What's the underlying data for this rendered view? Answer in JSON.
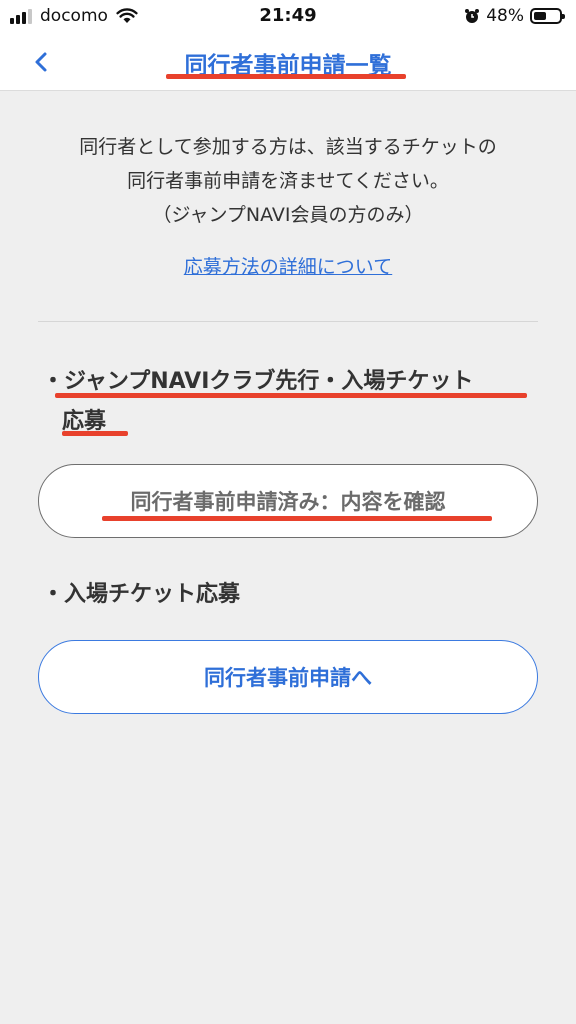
{
  "status_bar": {
    "carrier": "docomo",
    "time": "21:49",
    "battery_percent": "48%",
    "battery_level": 0.48
  },
  "nav": {
    "title": "同行者事前申請一覧",
    "back_icon": "chevron-left-icon"
  },
  "intro": {
    "line1": "同行者として参加する方は、該当するチケットの",
    "line2": "同行者事前申請を済ませてください。",
    "line3": "（ジャンプNAVI会員の方のみ）"
  },
  "detail_link": "応募方法の詳細について",
  "sections": [
    {
      "title_line1": "・ジャンプNAVIクラブ先行・入場チケット",
      "title_line2": "応募",
      "button_label": "同行者事前申請済み：内容を確認"
    },
    {
      "title_line1": "・入場チケット応募",
      "button_label": "同行者事前申請へ"
    }
  ],
  "colors": {
    "accent": "#2f6fd8",
    "annotation_red": "#e8412c",
    "background": "#efefef"
  }
}
